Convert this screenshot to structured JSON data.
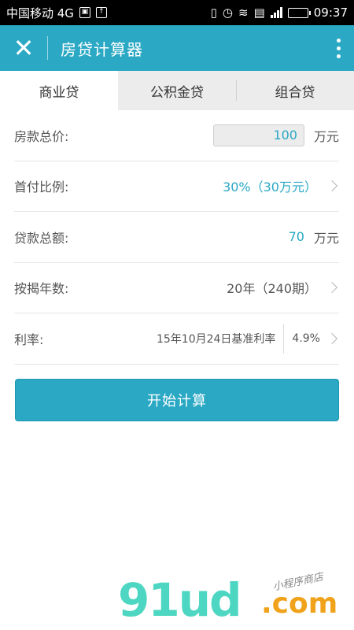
{
  "status_bar": {
    "carrier": "中国移动 4G",
    "time": "09:37",
    "network_label": "4G"
  },
  "app_bar": {
    "title": "房贷计算器",
    "close_icon": "close-icon",
    "more_icon": "more-vert-icon"
  },
  "tabs": [
    {
      "label": "商业贷",
      "active": true
    },
    {
      "label": "公积金贷",
      "active": false
    },
    {
      "label": "组合贷",
      "active": false
    }
  ],
  "form": {
    "total_price": {
      "label": "房款总价:",
      "value": "100",
      "unit": "万元"
    },
    "down_payment": {
      "label": "首付比例:",
      "value": "30%（30万元）"
    },
    "loan_amount": {
      "label": "贷款总额:",
      "value": "70",
      "unit": "万元"
    },
    "term": {
      "label": "按揭年数:",
      "value": "20年（240期）"
    },
    "rate": {
      "label": "利率:",
      "description": "15年10月24日基准利率",
      "value": "4.9%"
    }
  },
  "actions": {
    "calculate_label": "开始计算"
  },
  "watermark": {
    "logo": "91ud",
    "suffix": ".com",
    "tagline": "小程序商店"
  },
  "colors": {
    "accent": "#2aa8c4",
    "status_bar_bg": "#000000",
    "tab_inactive_bg": "#ececec"
  }
}
